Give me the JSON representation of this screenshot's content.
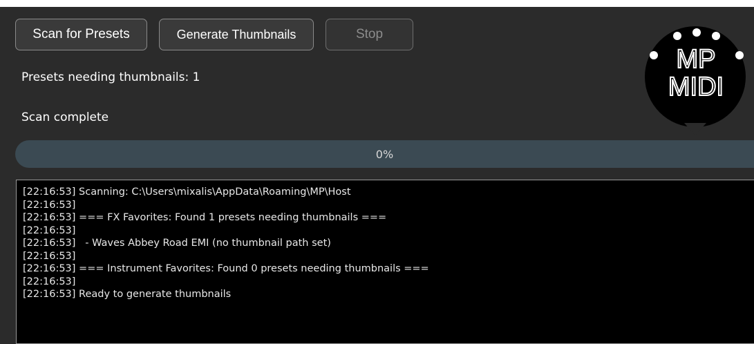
{
  "toolbar": {
    "scan_label": "Scan for Presets",
    "generate_label": "Generate Thumbnails",
    "stop_label": "Stop"
  },
  "status": {
    "count_text": "Presets needing thumbnails: 1",
    "scan_text": "Scan complete"
  },
  "logo": {
    "top_text": "MP",
    "bottom_text": "MIDI"
  },
  "progress": {
    "value": 0,
    "label": "0%"
  },
  "log": {
    "lines": [
      "[22:16:53] Scanning: C:\\Users\\mixalis\\AppData\\Roaming\\MP\\Host",
      "[22:16:53]",
      "[22:16:53] === FX Favorites: Found 1 presets needing thumbnails ===",
      "[22:16:53]",
      "[22:16:53]   - Waves Abbey Road EMI (no thumbnail path set)",
      "[22:16:53]",
      "[22:16:53] === Instrument Favorites: Found 0 presets needing thumbnails ===",
      "[22:16:53]",
      "[22:16:53] Ready to generate thumbnails"
    ]
  },
  "colors": {
    "background": "#2b2b2b",
    "button_border": "#8a8a8a",
    "progress_track": "#3b4a53",
    "log_background": "#000000"
  }
}
